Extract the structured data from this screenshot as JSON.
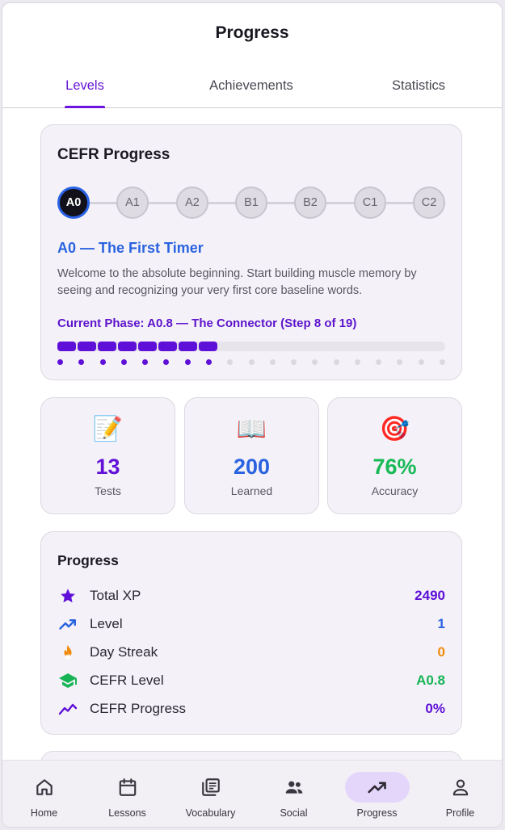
{
  "header": {
    "title": "Progress"
  },
  "tabs": [
    {
      "label": "Levels",
      "active": true
    },
    {
      "label": "Achievements",
      "active": false
    },
    {
      "label": "Statistics",
      "active": false
    }
  ],
  "cefr": {
    "title": "CEFR Progress",
    "levels": [
      "A0",
      "A1",
      "A2",
      "B1",
      "B2",
      "C1",
      "C2"
    ],
    "current_level": "A0",
    "level_name": "A0 — The First Timer",
    "description": "Welcome to the absolute beginning. Start building muscle memory by seeing and recognizing your very first core baseline words.",
    "phase_text": "Current Phase: A0.8 — The Connector (Step 8 of 19)",
    "steps_done": 8,
    "steps_total": 19,
    "accent_color": "#5e0fd8"
  },
  "stats": [
    {
      "icon": "memo-emoji",
      "emoji": "📝",
      "value": "13",
      "label": "Tests",
      "color": "#6211d6"
    },
    {
      "icon": "book-emoji",
      "emoji": "📖",
      "value": "200",
      "label": "Learned",
      "color": "#2a63e0"
    },
    {
      "icon": "target-emoji",
      "emoji": "🎯",
      "value": "76%",
      "label": "Accuracy",
      "color": "#18b957"
    }
  ],
  "progress": {
    "title": "Progress",
    "rows": [
      {
        "icon": "star-icon",
        "label": "Total XP",
        "value": "2490",
        "color": "#5e0fd8"
      },
      {
        "icon": "trending-up-icon",
        "label": "Level",
        "value": "1",
        "color": "#2a63e0"
      },
      {
        "icon": "fire-icon",
        "label": "Day Streak",
        "value": "0",
        "color": "#f08a0c"
      },
      {
        "icon": "graduation-cap-icon",
        "label": "CEFR Level",
        "value": "A0.8",
        "color": "#17b456"
      },
      {
        "icon": "chart-line-icon",
        "label": "CEFR Progress",
        "value": "0%",
        "color": "#5e0fd8"
      }
    ]
  },
  "nav": [
    {
      "icon": "home-icon",
      "label": "Home",
      "active": false
    },
    {
      "icon": "calendar-icon",
      "label": "Lessons",
      "active": false
    },
    {
      "icon": "book-stack-icon",
      "label": "Vocabulary",
      "active": false
    },
    {
      "icon": "people-icon",
      "label": "Social",
      "active": false
    },
    {
      "icon": "trending-icon",
      "label": "Progress",
      "active": true
    },
    {
      "icon": "person-icon",
      "label": "Profile",
      "active": false
    }
  ]
}
